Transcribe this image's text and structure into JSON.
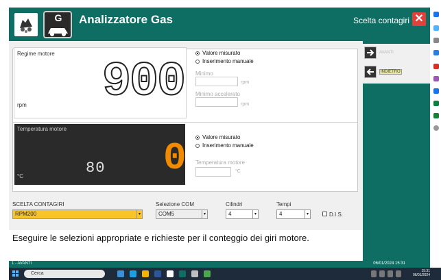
{
  "window": {
    "title": "Analizzatore Gas",
    "logo_letter": "G",
    "choose_label": "Scelta contagiri",
    "close_glyph": "✕"
  },
  "side": {
    "btn1_label": "AVANTI",
    "btn2_label": "INDIETRO",
    "btn2_badge": "INDIETRO"
  },
  "rpm_panel": {
    "title": "Regime motore",
    "value": "900",
    "unit": "rpm",
    "radio_measured": "Valore misurato",
    "radio_manual": "Inserimento manuale",
    "minimum_label": "Minimo",
    "minimum_unit": "rpm",
    "min_accel_label": "Minimo accelerato",
    "min_accel_unit": "rpm"
  },
  "temp_panel": {
    "title": "Temperatura motore",
    "value": "0",
    "small_value": "80",
    "unit": "°C",
    "radio_measured": "Valore misurato",
    "radio_manual": "Inserimento manuale",
    "manual_label": "Temperatura motore",
    "manual_unit": "°C"
  },
  "selectors": {
    "counter_label": "SCELTA CONTAGIRI",
    "counter_value": "RPM200",
    "com_label": "Selezione COM",
    "com_value": "COM5",
    "cyl_label": "Cilindri",
    "cyl_value": "4",
    "times_label": "Tempi",
    "times_value": "4",
    "dis_label": "D.I.S."
  },
  "message": "Eseguire le selezioni appropriate e richieste per il conteggio dei giri motore.",
  "status": {
    "left": "1 - AVANTI",
    "right": "06/01/2024 15:31"
  },
  "taskbar": {
    "search_text": "Cerca",
    "time": "15:31",
    "date": "06/01/2024"
  },
  "colors": {
    "accent_green": "#0f6e64",
    "counter_highlight": "#f7c52a",
    "temp_digit": "#f08a00"
  }
}
